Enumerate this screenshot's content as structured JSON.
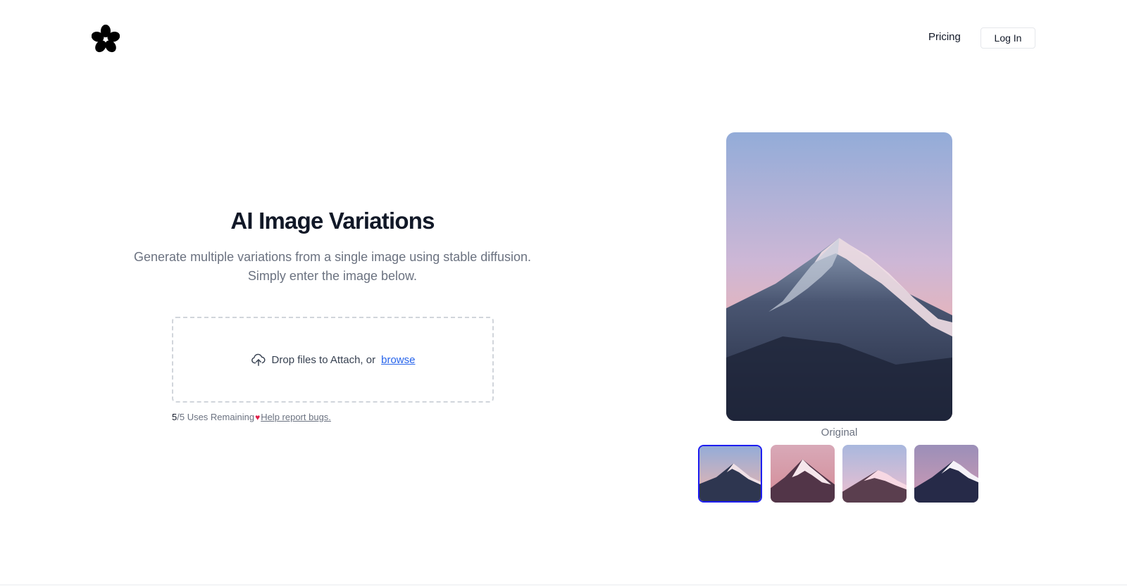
{
  "header": {
    "logo_icon": "flower-logo-icon",
    "nav": {
      "pricing": "Pricing"
    },
    "login_label": "Log In"
  },
  "hero": {
    "title": "AI Image Variations",
    "subtitle_line1": "Generate multiple variations from a single image using stable diffusion.",
    "subtitle_line2": "Simply enter the image below."
  },
  "dropzone": {
    "icon": "cloud-upload-icon",
    "text": "Drop files to Attach, or",
    "browse": "browse"
  },
  "usage": {
    "used": "5",
    "total_text": "/5 Uses Remaining",
    "heart_icon": "heart-icon",
    "bug_link": "Help report bugs."
  },
  "showcase": {
    "caption": "Original",
    "selected_index": 0,
    "thumbnails": [
      "original",
      "variation-1",
      "variation-2",
      "variation-3"
    ]
  },
  "colors": {
    "accent_link": "#2563eb",
    "selected_border": "#1d1df0",
    "heart": "#e11d48"
  }
}
